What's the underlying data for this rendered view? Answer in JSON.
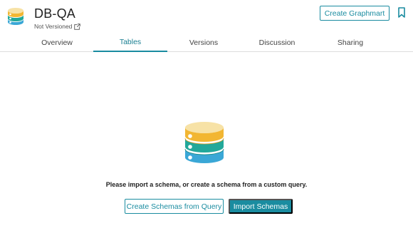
{
  "header": {
    "title": "DB-QA",
    "version_status": "Not Versioned",
    "create_graphmart_label": "Create Graphmart"
  },
  "tabs": [
    {
      "label": "Overview",
      "active": false
    },
    {
      "label": "Tables",
      "active": true
    },
    {
      "label": "Versions",
      "active": false
    },
    {
      "label": "Discussion",
      "active": false
    },
    {
      "label": "Sharing",
      "active": false
    }
  ],
  "empty_state": {
    "message": "Please import a schema, or create a schema from a custom query.",
    "create_from_query_label": "Create Schemas from Query",
    "import_label": "Import Schemas"
  },
  "colors": {
    "accent": "#1a8ca0",
    "db_yellow": "#f2b632",
    "db_teal": "#22a89a",
    "db_blue": "#3aa7d6"
  },
  "icons": [
    "database-icon",
    "external-link-icon",
    "bookmark-icon"
  ]
}
